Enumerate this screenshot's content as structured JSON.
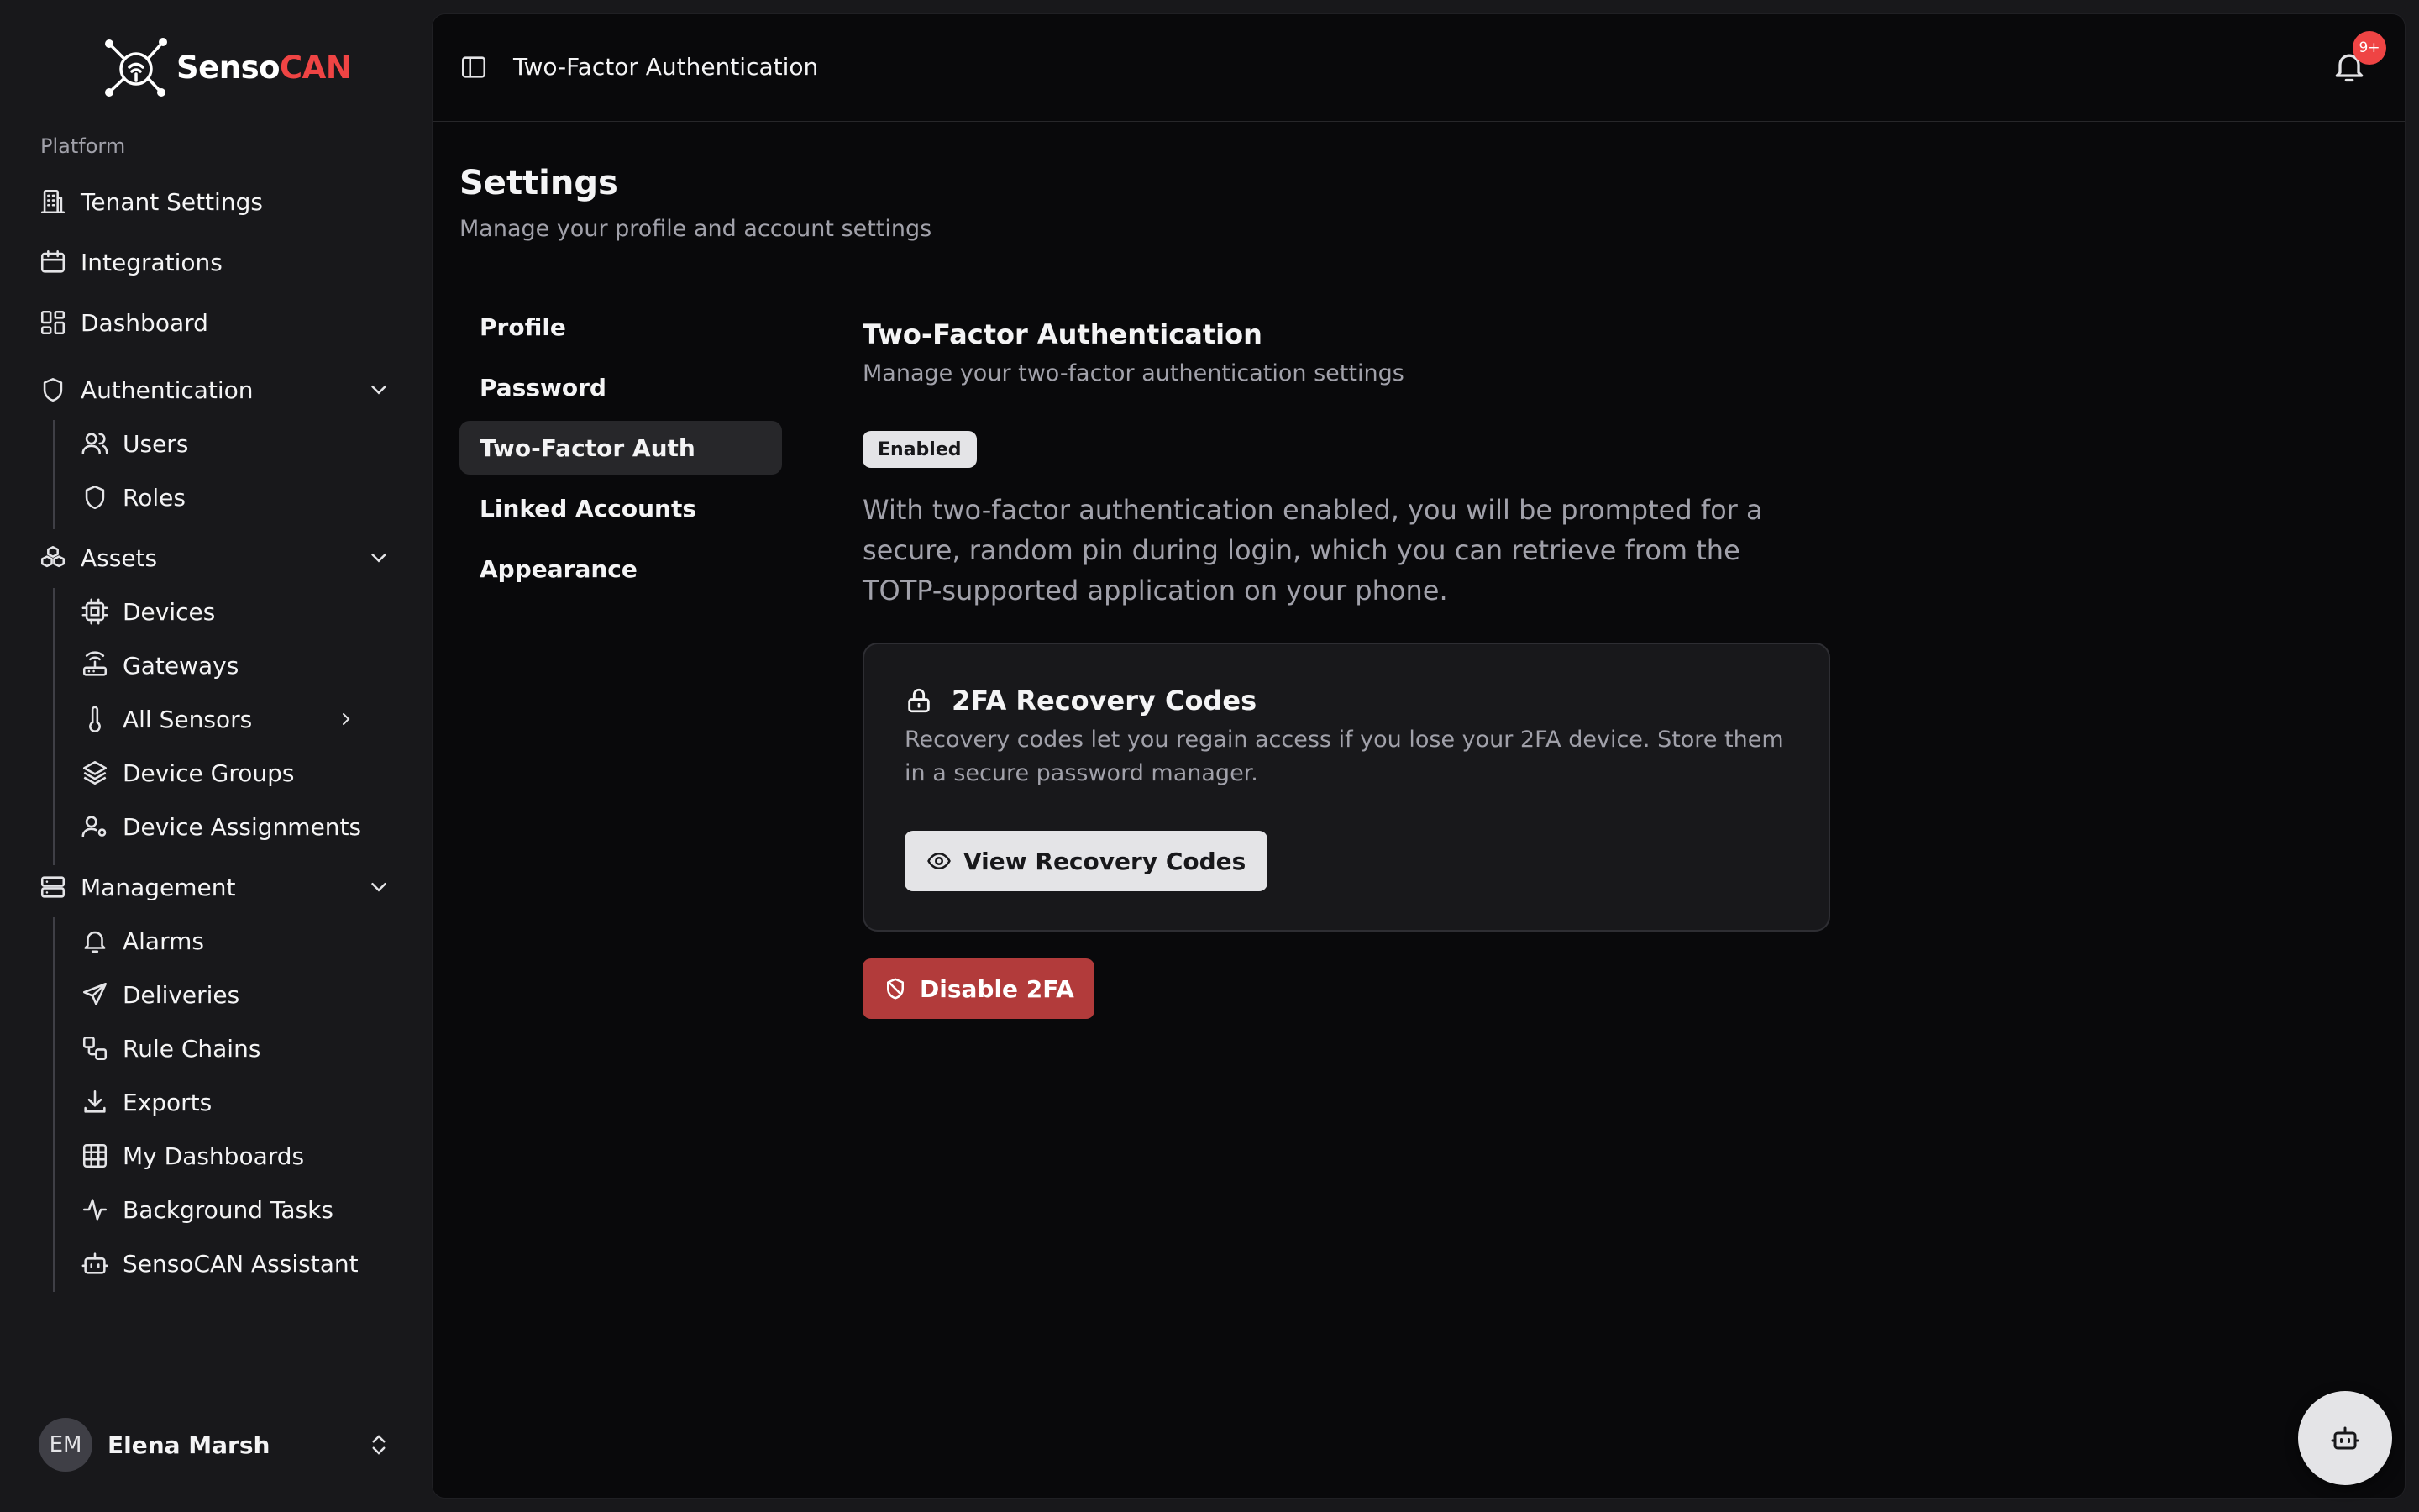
{
  "brand": {
    "name_part1": "Senso",
    "name_part2": "CAN"
  },
  "sidebar": {
    "group_label": "Platform",
    "items": {
      "tenant_settings": "Tenant Settings",
      "integrations": "Integrations",
      "dashboard": "Dashboard",
      "authentication": "Authentication",
      "users": "Users",
      "roles": "Roles",
      "assets": "Assets",
      "devices": "Devices",
      "gateways": "Gateways",
      "all_sensors": "All Sensors",
      "device_groups": "Device Groups",
      "device_assignments": "Device Assignments",
      "management": "Management",
      "alarms": "Alarms",
      "deliveries": "Deliveries",
      "rule_chains": "Rule Chains",
      "exports": "Exports",
      "my_dashboards": "My Dashboards",
      "background_tasks": "Background Tasks",
      "sensocan_assistant": "SensoCAN Assistant"
    },
    "user": {
      "initials": "EM",
      "name": "Elena Marsh"
    }
  },
  "topbar": {
    "title": "Two-Factor Authentication",
    "notification_count": "9+"
  },
  "page": {
    "title": "Settings",
    "subtitle": "Manage your profile and account settings"
  },
  "tabs": {
    "profile": "Profile",
    "password": "Password",
    "two_factor": "Two-Factor Auth",
    "linked_accounts": "Linked Accounts",
    "appearance": "Appearance",
    "active": "two_factor"
  },
  "two_factor": {
    "title": "Two-Factor Authentication",
    "subtitle": "Manage your two-factor authentication settings",
    "status": "Enabled",
    "description": "With two-factor authentication enabled, you will be prompted for a secure, random pin during login, which you can retrieve from the TOTP-supported application on your phone.",
    "recovery": {
      "title": "2FA Recovery Codes",
      "description": "Recovery codes let you regain access if you lose your 2FA device. Store them in a secure password manager.",
      "button": "View Recovery Codes"
    },
    "disable_button": "Disable 2FA"
  },
  "colors": {
    "brand_accent": "#ef4444",
    "danger_button": "#b23b3b",
    "badge": "#ef4444"
  }
}
